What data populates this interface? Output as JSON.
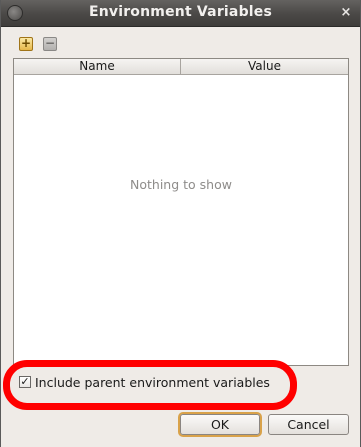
{
  "window": {
    "title": "Environment Variables"
  },
  "titlebar": {
    "close_glyph": "×"
  },
  "toolbar": {
    "add_glyph": "+",
    "remove_glyph": "−"
  },
  "table": {
    "columns": [
      "Name",
      "Value"
    ],
    "empty_message": "Nothing to show"
  },
  "options": {
    "include_parent": {
      "label": "Include parent environment variables",
      "checked": true,
      "check_glyph": "✓"
    }
  },
  "buttons": {
    "ok_label": "OK",
    "cancel_label": "Cancel"
  },
  "annotation": {
    "highlight_color": "#ff0000"
  }
}
